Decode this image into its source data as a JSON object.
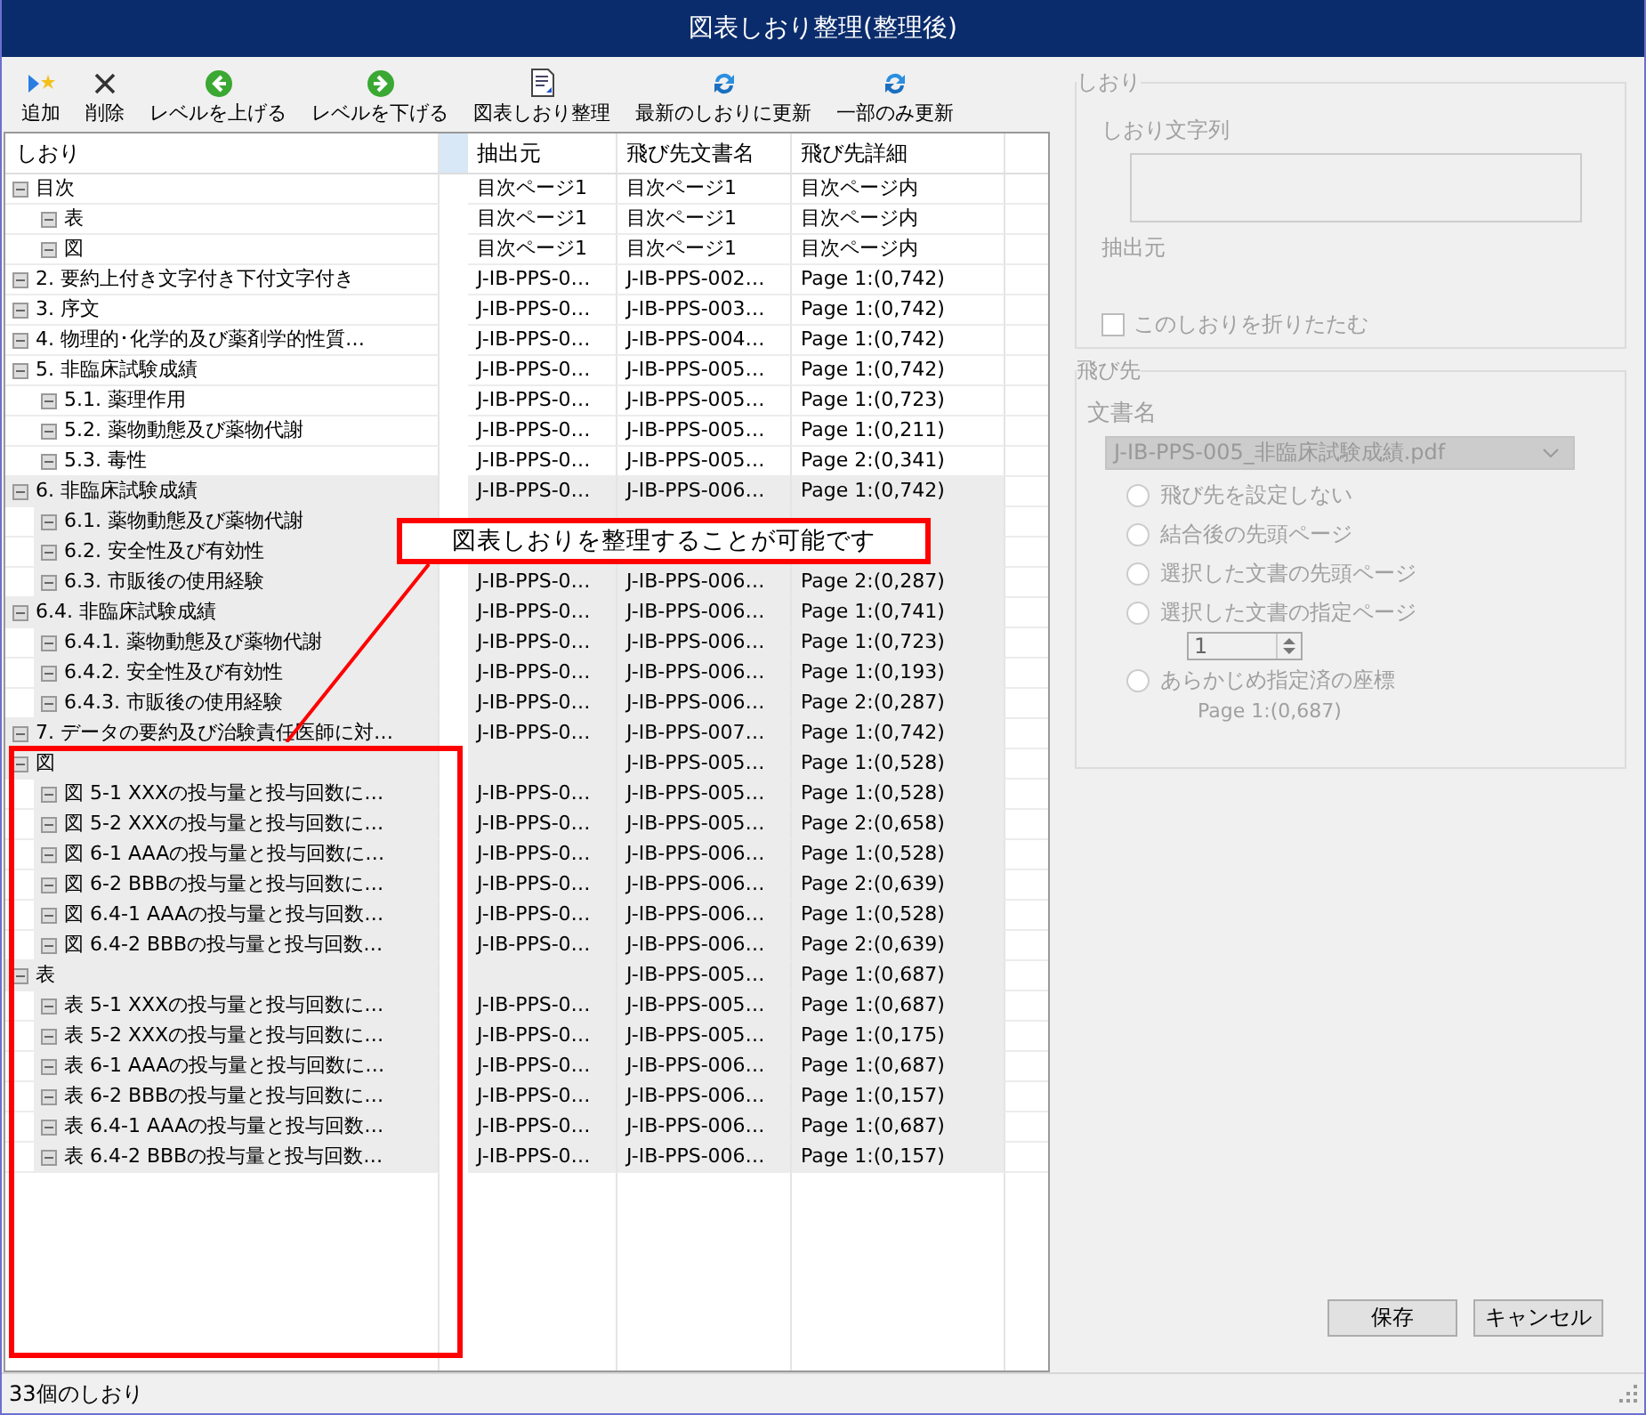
{
  "window": {
    "title": "図表しおり整理(整理後)"
  },
  "toolbar": [
    {
      "kind": "add",
      "label": "追加"
    },
    {
      "kind": "delete",
      "label": "削除"
    },
    {
      "kind": "up",
      "label": "レベルを上げる"
    },
    {
      "kind": "down",
      "label": "レベルを下げる"
    },
    {
      "kind": "organize",
      "label": "図表しおり整理"
    },
    {
      "kind": "refresh",
      "label": "最新のしおりに更新"
    },
    {
      "kind": "refresh",
      "label": "一部のみ更新"
    }
  ],
  "columns": [
    "しおり",
    "抽出元",
    "飛び先文書名",
    "飛び先詳細"
  ],
  "bookmarks": [
    {
      "label": "目次",
      "source": "目次ページ1",
      "document": "目次ページ1",
      "detail": "目次ページ内",
      "selected": false,
      "children": [
        {
          "label": "表",
          "source": "目次ページ1",
          "document": "目次ページ1",
          "detail": "目次ページ内",
          "selected": false
        },
        {
          "label": "図",
          "source": "目次ページ1",
          "document": "目次ページ1",
          "detail": "目次ページ内",
          "selected": false
        }
      ]
    },
    {
      "label": "2. 要約上付き文字付き下付文字付き",
      "source": "J-IB-PPS-0…",
      "document": "J-IB-PPS-002…",
      "detail": "Page 1:(0,742)",
      "selected": false
    },
    {
      "label": "3. 序文",
      "source": "J-IB-PPS-0…",
      "document": "J-IB-PPS-003…",
      "detail": "Page 1:(0,742)",
      "selected": false
    },
    {
      "label": "4. 物理的･化学的及び薬剤学的性質…",
      "source": "J-IB-PPS-0…",
      "document": "J-IB-PPS-004…",
      "detail": "Page 1:(0,742)",
      "selected": false
    },
    {
      "label": "5. 非臨床試験成績",
      "source": "J-IB-PPS-0…",
      "document": "J-IB-PPS-005…",
      "detail": "Page 1:(0,742)",
      "selected": false,
      "children": [
        {
          "label": "5.1. 薬理作用",
          "source": "J-IB-PPS-0…",
          "document": "J-IB-PPS-005…",
          "detail": "Page 1:(0,723)",
          "selected": false
        },
        {
          "label": "5.2. 薬物動態及び薬物代謝",
          "source": "J-IB-PPS-0…",
          "document": "J-IB-PPS-005…",
          "detail": "Page 1:(0,211)",
          "selected": false
        },
        {
          "label": "5.3. 毒性",
          "source": "J-IB-PPS-0…",
          "document": "J-IB-PPS-005…",
          "detail": "Page 2:(0,341)",
          "selected": false
        }
      ]
    },
    {
      "label": "6. 非臨床試験成績",
      "source": "J-IB-PPS-0…",
      "document": "J-IB-PPS-006…",
      "detail": "Page 1:(0,742)",
      "selected": true,
      "children": [
        {
          "label": "6.1. 薬物動態及び薬物代謝",
          "selected": true
        },
        {
          "label": "6.2. 安全性及び有効性",
          "selected": true
        },
        {
          "label": "6.3. 市販後の使用経験",
          "source": "J-IB-PPS-0…",
          "document": "J-IB-PPS-006…",
          "detail": "Page 2:(0,287)",
          "selected": true
        }
      ]
    },
    {
      "label": "6.4. 非臨床試験成績",
      "source": "J-IB-PPS-0…",
      "document": "J-IB-PPS-006…",
      "detail": "Page 1:(0,741)",
      "selected": true,
      "children": [
        {
          "label": "6.4.1. 薬物動態及び薬物代謝",
          "source": "J-IB-PPS-0…",
          "document": "J-IB-PPS-006…",
          "detail": "Page 1:(0,723)",
          "selected": true
        },
        {
          "label": "6.4.2. 安全性及び有効性",
          "source": "J-IB-PPS-0…",
          "document": "J-IB-PPS-006…",
          "detail": "Page 1:(0,193)",
          "selected": true
        },
        {
          "label": "6.4.3. 市販後の使用経験",
          "source": "J-IB-PPS-0…",
          "document": "J-IB-PPS-006…",
          "detail": "Page 2:(0,287)",
          "selected": true
        }
      ]
    },
    {
      "label": "7. データの要約及び治験責任医師に対…",
      "source": "J-IB-PPS-0…",
      "document": "J-IB-PPS-007…",
      "detail": "Page 1:(0,742)",
      "selected": true
    },
    {
      "label": "図",
      "document": "J-IB-PPS-005…",
      "detail": "Page 1:(0,528)",
      "selected": true,
      "children": [
        {
          "label": "図 5-1 XXXの投与量と投与回数に…",
          "source": "J-IB-PPS-0…",
          "document": "J-IB-PPS-005…",
          "detail": "Page 1:(0,528)",
          "selected": true
        },
        {
          "label": "図 5-2 XXXの投与量と投与回数に…",
          "source": "J-IB-PPS-0…",
          "document": "J-IB-PPS-005…",
          "detail": "Page 2:(0,658)",
          "selected": true
        },
        {
          "label": "図 6-1 AAAの投与量と投与回数に…",
          "source": "J-IB-PPS-0…",
          "document": "J-IB-PPS-006…",
          "detail": "Page 1:(0,528)",
          "selected": true
        },
        {
          "label": "図 6-2 BBBの投与量と投与回数に…",
          "source": "J-IB-PPS-0…",
          "document": "J-IB-PPS-006…",
          "detail": "Page 2:(0,639)",
          "selected": true
        },
        {
          "label": "図 6.4-1 AAAの投与量と投与回数…",
          "source": "J-IB-PPS-0…",
          "document": "J-IB-PPS-006…",
          "detail": "Page 1:(0,528)",
          "selected": true
        },
        {
          "label": "図 6.4-2 BBBの投与量と投与回数…",
          "source": "J-IB-PPS-0…",
          "document": "J-IB-PPS-006…",
          "detail": "Page 2:(0,639)",
          "selected": true
        }
      ]
    },
    {
      "label": "表",
      "document": "J-IB-PPS-005…",
      "detail": "Page 1:(0,687)",
      "selected": true,
      "children": [
        {
          "label": "表 5-1 XXXの投与量と投与回数に…",
          "source": "J-IB-PPS-0…",
          "document": "J-IB-PPS-005…",
          "detail": "Page 1:(0,687)",
          "selected": true
        },
        {
          "label": "表 5-2 XXXの投与量と投与回数に…",
          "source": "J-IB-PPS-0…",
          "document": "J-IB-PPS-005…",
          "detail": "Page 1:(0,175)",
          "selected": true
        },
        {
          "label": "表 6-1 AAAの投与量と投与回数に…",
          "source": "J-IB-PPS-0…",
          "document": "J-IB-PPS-006…",
          "detail": "Page 1:(0,687)",
          "selected": true
        },
        {
          "label": "表 6-2 BBBの投与量と投与回数に…",
          "source": "J-IB-PPS-0…",
          "document": "J-IB-PPS-006…",
          "detail": "Page 1:(0,157)",
          "selected": true
        },
        {
          "label": "表 6.4-1 AAAの投与量と投与回数…",
          "source": "J-IB-PPS-0…",
          "document": "J-IB-PPS-006…",
          "detail": "Page 1:(0,687)",
          "selected": true
        },
        {
          "label": "表 6.4-2 BBBの投与量と投与回数…",
          "source": "J-IB-PPS-0…",
          "document": "J-IB-PPS-006…",
          "detail": "Page 1:(0,157)",
          "selected": true
        }
      ]
    }
  ],
  "callout": {
    "text": "図表しおりを整理することが可能です"
  },
  "bookmark_group": {
    "title": "しおり",
    "text_label": "しおり文字列",
    "source_label": "抽出元",
    "collapse": {
      "label": "このしおりを折りたたむ",
      "checked": false
    },
    "disabled": true
  },
  "target_group": {
    "title": "飛び先",
    "document_label": "文書名",
    "document": "J-IB-PPS-005_非臨床試験成績.pdf",
    "disabled": true,
    "options": [
      {
        "label": "飛び先を設定しない",
        "selected": false
      },
      {
        "label": "結合後の先頭ページ",
        "selected": false
      },
      {
        "label": "選択した文書の先頭ページ",
        "selected": false
      },
      {
        "label": "選択した文書の指定ページ",
        "selected": false,
        "spin": "1"
      },
      {
        "label": "あらかじめ指定済の座標",
        "selected": false,
        "note": "Page 1:(0,687)"
      }
    ]
  },
  "buttons": [
    "保存",
    "キャンセル"
  ],
  "status_bar": "33個のしおり"
}
